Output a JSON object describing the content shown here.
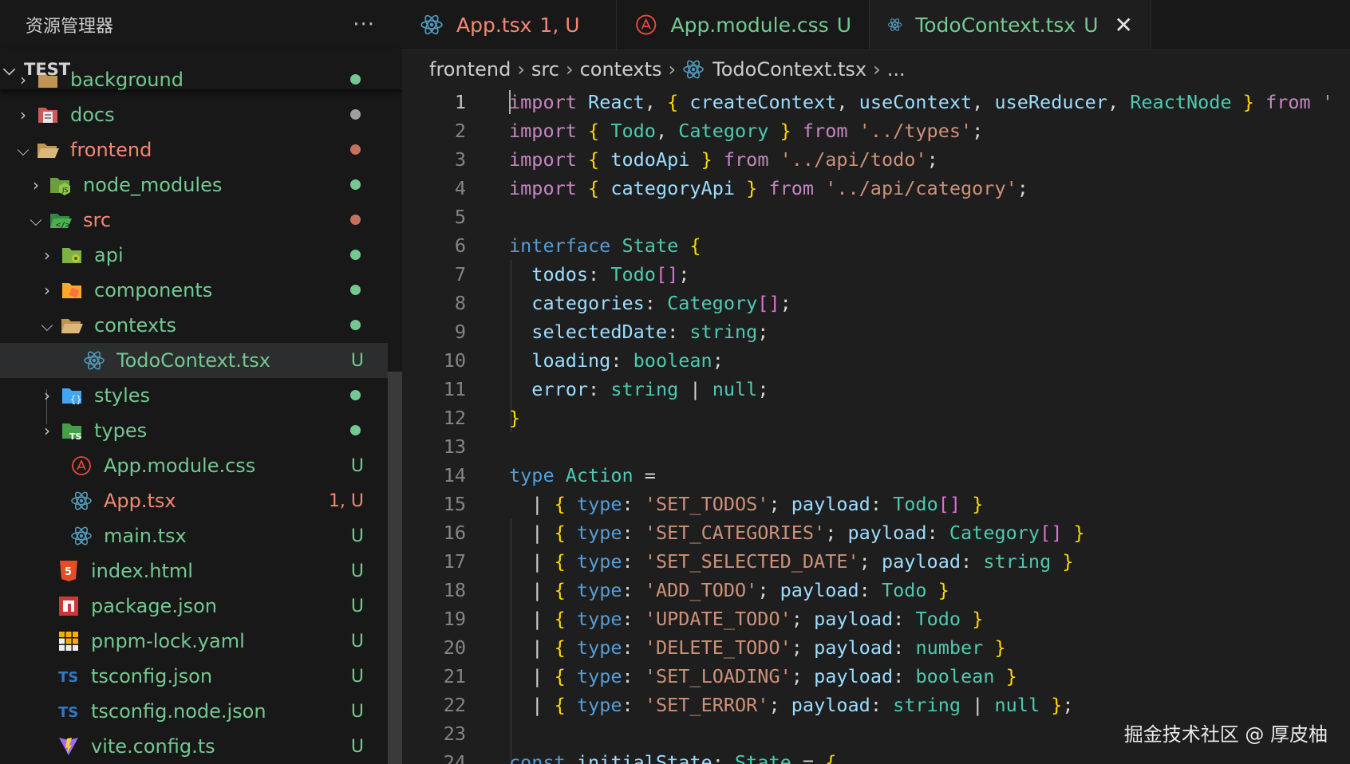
{
  "colors": {
    "git_untracked": "#73c991",
    "git_error": "#f48771",
    "folder_label": "#73c991"
  },
  "sidebar": {
    "title": "资源管理器",
    "more_icon": "ellipsis-icon",
    "section": "TEST",
    "items": [
      {
        "label": "background",
        "status": "",
        "icon": "folder-icon"
      },
      {
        "label": "docs",
        "status": "",
        "icon": "folder-docs-icon"
      },
      {
        "label": "frontend",
        "status": "",
        "icon": "folder-open-icon"
      },
      {
        "label": "node_modules",
        "status": "",
        "icon": "folder-node-icon"
      },
      {
        "label": "src",
        "status": "",
        "icon": "folder-src-icon"
      },
      {
        "label": "api",
        "status": "",
        "icon": "folder-api-icon"
      },
      {
        "label": "components",
        "status": "",
        "icon": "folder-components-icon"
      },
      {
        "label": "contexts",
        "status": "",
        "icon": "folder-open-icon"
      },
      {
        "label": "TodoContext.tsx",
        "status": "U",
        "icon": "react-icon"
      },
      {
        "label": "styles",
        "status": "",
        "icon": "folder-styles-icon"
      },
      {
        "label": "types",
        "status": "",
        "icon": "folder-types-icon"
      },
      {
        "label": "App.module.css",
        "status": "U",
        "icon": "css-icon"
      },
      {
        "label": "App.tsx",
        "status": "1, U",
        "icon": "react-icon"
      },
      {
        "label": "main.tsx",
        "status": "U",
        "icon": "react-icon"
      },
      {
        "label": "index.html",
        "status": "U",
        "icon": "html-icon"
      },
      {
        "label": "package.json",
        "status": "U",
        "icon": "npm-icon"
      },
      {
        "label": "pnpm-lock.yaml",
        "status": "U",
        "icon": "pnpm-icon"
      },
      {
        "label": "tsconfig.json",
        "status": "U",
        "icon": "typescript-icon"
      },
      {
        "label": "tsconfig.node.json",
        "status": "U",
        "icon": "typescript-icon"
      },
      {
        "label": "vite.config.ts",
        "status": "U",
        "icon": "vite-icon"
      }
    ]
  },
  "tabs": [
    {
      "label": "App.tsx",
      "status": "1, U",
      "icon": "react-icon"
    },
    {
      "label": "App.module.css",
      "status": "U",
      "icon": "css-icon"
    },
    {
      "label": "TodoContext.tsx",
      "status": "U",
      "icon": "react-icon",
      "close_icon": "close-icon"
    }
  ],
  "breadcrumb": [
    "frontend",
    "src",
    "contexts",
    "TodoContext.tsx",
    "..."
  ],
  "code": {
    "line_numbers": [
      "1",
      "2",
      "3",
      "4",
      "5",
      "6",
      "7",
      "8",
      "9",
      "10",
      "11",
      "12",
      "13",
      "14",
      "15",
      "16",
      "17",
      "18",
      "19",
      "20",
      "21",
      "22",
      "23",
      "24"
    ],
    "lines": [
      "import React, { createContext, useContext, useReducer, ReactNode } from '",
      "import { Todo, Category } from '../types';",
      "import { todoApi } from '../api/todo';",
      "import { categoryApi } from '../api/category';",
      "",
      "interface State {",
      "  todos: Todo[];",
      "  categories: Category[];",
      "  selectedDate: string;",
      "  loading: boolean;",
      "  error: string | null;",
      "}",
      "",
      "type Action =",
      "  | { type: 'SET_TODOS'; payload: Todo[] }",
      "  | { type: 'SET_CATEGORIES'; payload: Category[] }",
      "  | { type: 'SET_SELECTED_DATE'; payload: string }",
      "  | { type: 'ADD_TODO'; payload: Todo }",
      "  | { type: 'UPDATE_TODO'; payload: Todo }",
      "  | { type: 'DELETE_TODO'; payload: number }",
      "  | { type: 'SET_LOADING'; payload: boolean }",
      "  | { type: 'SET_ERROR'; payload: string | null };",
      "",
      "const initialState: State = {"
    ]
  },
  "watermark": "掘金技术社区 @ 厚皮柚"
}
